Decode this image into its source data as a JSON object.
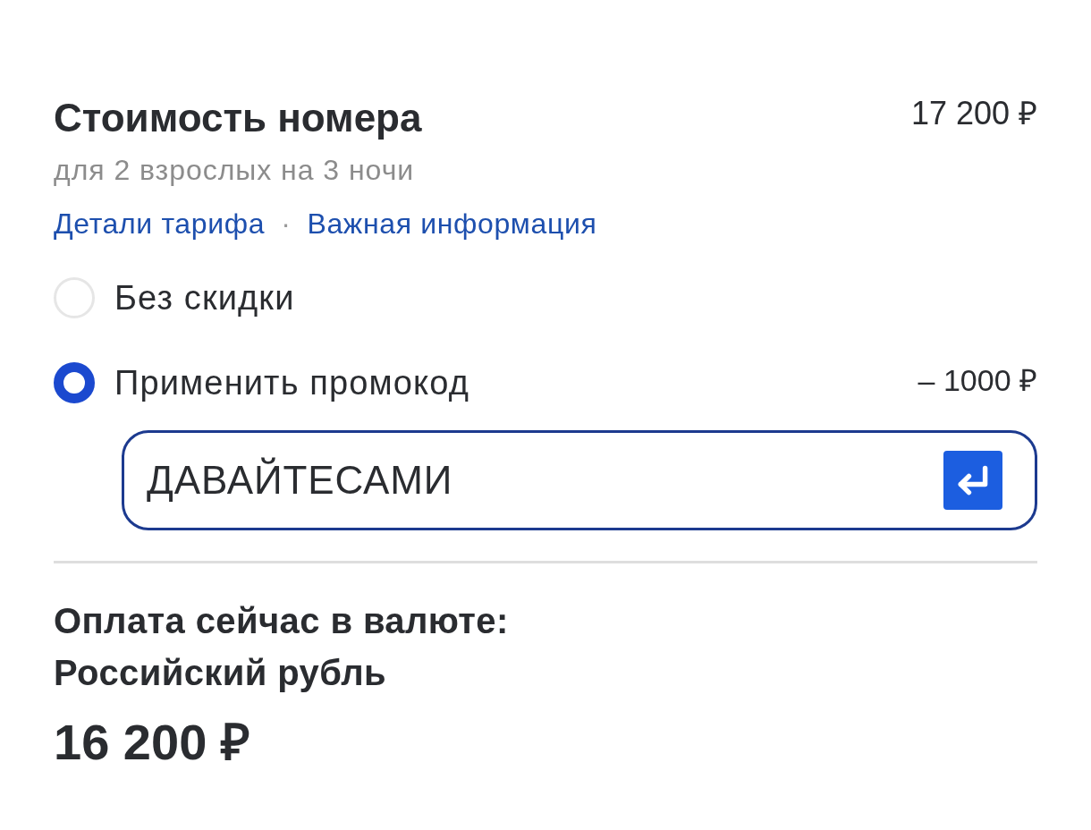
{
  "room_cost": {
    "title": "Стоимость номера",
    "price": "17 200 ₽",
    "subtitle": "для 2 взрослых на 3 ночи"
  },
  "links": [
    {
      "label": "Детали тарифа"
    },
    {
      "label": "Важная информация"
    }
  ],
  "link_separator": "·",
  "discount_options": [
    {
      "label": "Без скидки",
      "selected": false
    },
    {
      "label": "Применить промокод",
      "selected": true,
      "amount": "– 1000 ₽"
    }
  ],
  "promo_code": {
    "value": "ДАВАЙТЕСАМИ"
  },
  "payment": {
    "label": "Оплата сейчас в валюте:",
    "currency": "Российский рубль",
    "total": "16 200 ₽"
  }
}
